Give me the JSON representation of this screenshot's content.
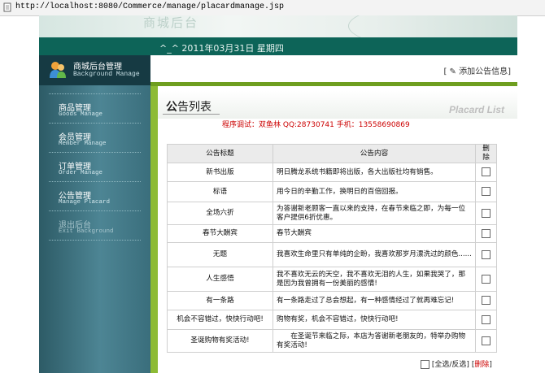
{
  "browser": {
    "url": "http://localhost:8080/Commerce/manage/placardmanage.jsp"
  },
  "banner": {
    "ghost_text": "商城后台"
  },
  "datebar": {
    "date": "^_^ 2011年03月31日 星期四"
  },
  "sidebar": {
    "header": {
      "title": "商城后台管理",
      "subtitle": "Background Manage"
    },
    "items": [
      {
        "label": "商品管理",
        "en": "Goods Manage"
      },
      {
        "label": "会员管理",
        "en": "Member Manage"
      },
      {
        "label": "订单管理",
        "en": "Order Manage"
      },
      {
        "label": "公告管理",
        "en": "Manage Placard"
      },
      {
        "label": "退出后台",
        "en": "Exit Background"
      }
    ]
  },
  "toolbar": {
    "add_label": "[ ✎ 添加公告信息]"
  },
  "panel": {
    "title_bold": "公",
    "title_rest": "告列表",
    "title_en": "Placard List",
    "credit": "程序调试：双鱼林  QQ:28730741  手机：13558690869"
  },
  "table": {
    "headers": [
      "公告标题",
      "公告内容",
      "删除"
    ],
    "rows": [
      {
        "title": "新书出版",
        "content": "明日腾龙系统书籍即将出版，各大出版社均有销售。"
      },
      {
        "title": "标语",
        "content": "用今日的辛勤工作，换明日的百倍回报。"
      },
      {
        "title": "全场六折",
        "content": "为答谢新老顾客一直以来的支持，在春节来临之即，为每一位客户提供6折优惠。"
      },
      {
        "title": "春节大酬宾",
        "content": "春节大酬宾"
      },
      {
        "title": "无题",
        "content": "我喜欢生命里只有单纯的企盼，我喜欢那岁月漂洗过的颜色......"
      },
      {
        "title": "人生感悟",
        "content": "我不喜欢无云的天空，我不喜欢无泪的人生，如果我哭了，那是因为我曾拥有一份美丽的感情!"
      },
      {
        "title": "有一条路",
        "content": "有一条路走过了总会想起，有一种感情经过了就再难忘记!"
      },
      {
        "title": "机会不容错过，快快行动吧!",
        "content": "购物有奖，机会不容错过，快快行动吧!"
      },
      {
        "title": "圣诞购物有奖活动!",
        "content": "　　在圣诞节来临之际，本店为答谢新老朋友的，特举办购物有奖活动!"
      }
    ]
  },
  "footer": {
    "select_all": "[全选/反选]",
    "delete_label": "删除"
  },
  "colors": {
    "nav_dark": "#163a43",
    "datebar": "#0d6458",
    "accent_green": "#6e9e1f",
    "credit_red": "#cc0000"
  }
}
